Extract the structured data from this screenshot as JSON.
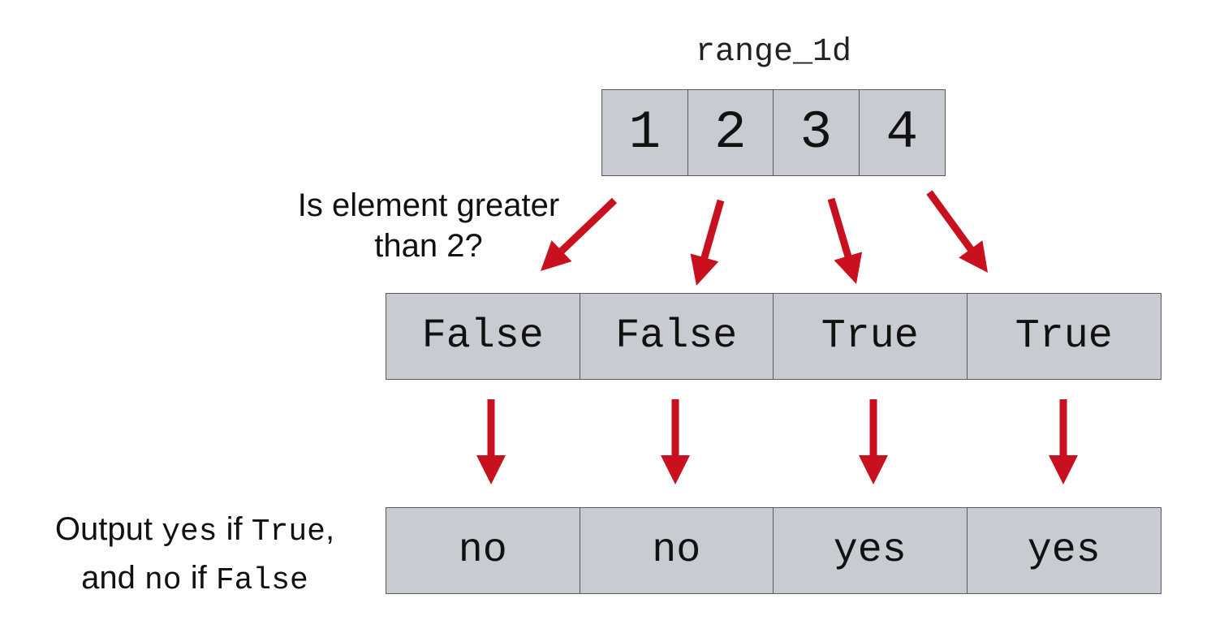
{
  "array_name": "range_1d",
  "input_values": [
    "1",
    "2",
    "3",
    "4"
  ],
  "question": {
    "line1": "Is element greater",
    "line2": "than 2?"
  },
  "boolean_values": [
    "False",
    "False",
    "True",
    "True"
  ],
  "output_rule": {
    "part1": "Output ",
    "code_yes": "yes",
    "part2": " if ",
    "code_true": "True",
    "part3": ",",
    "part4": "and ",
    "code_no": "no",
    "part5": " if ",
    "code_false": "False"
  },
  "output_values": [
    "no",
    "no",
    "yes",
    "yes"
  ],
  "colors": {
    "cell_fill": "#c8cbd1",
    "cell_border": "#5a5a5a",
    "arrow": "#c8101e"
  }
}
